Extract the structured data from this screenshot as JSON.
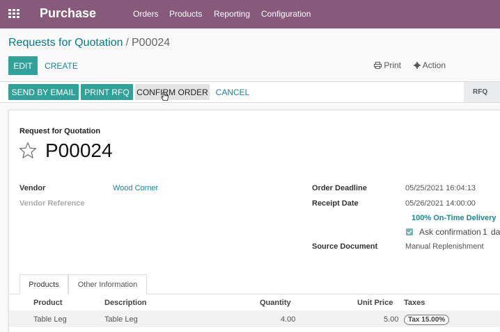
{
  "navbar": {
    "app_name": "Purchase",
    "menu": [
      {
        "label": "Orders"
      },
      {
        "label": "Products"
      },
      {
        "label": "Reporting"
      },
      {
        "label": "Configuration"
      }
    ],
    "color": "#875a7b"
  },
  "breadcrumb": {
    "parent": "Requests for Quotation",
    "separator": "/",
    "current": "P00024"
  },
  "toolbar": {
    "edit_label": "EDIT",
    "create_label": "CREATE",
    "print_label": "Print",
    "action_label": "Action"
  },
  "statusbar": {
    "send_email_label": "SEND BY EMAIL",
    "print_rfq_label": "PRINT RFQ",
    "confirm_label": "CONFIRM ORDER",
    "cancel_label": "CANCEL",
    "stage_label": "RFQ"
  },
  "form": {
    "doc_type": "Request for Quotation",
    "doc_name": "P00024",
    "vendor_label": "Vendor",
    "vendor_value": "Wood Corner",
    "vendor_ref_label": "Vendor Reference",
    "order_deadline_label": "Order Deadline",
    "order_deadline_value": "05/25/2021 16:04:13",
    "receipt_date_label": "Receipt Date",
    "receipt_date_value": "05/26/2021 14:00:00",
    "on_time_delivery": "100% On-Time Delivery",
    "ask_confirmation": "Ask confirmation",
    "ask_confirmation_days": "1",
    "ask_confirmation_unit": "da",
    "source_document_label": "Source Document",
    "source_document_value": "Manual Replenishment"
  },
  "tabs": [
    {
      "label": "Products",
      "active": true
    },
    {
      "label": "Other Information",
      "active": false
    }
  ],
  "order_lines": {
    "columns": [
      "Product",
      "Description",
      "Quantity",
      "Unit Price",
      "Taxes"
    ],
    "rows": [
      {
        "product": "Table Leg",
        "description": "Table Leg",
        "quantity": "4.00",
        "unit_price": "5.00",
        "taxes": "Tax 15.00%"
      }
    ]
  },
  "colors": {
    "primary": "#31a29a",
    "link": "#17888f",
    "brand": "#875a7b"
  },
  "icons": [
    "apps-grid-icon",
    "print-icon",
    "gear-icon",
    "star-icon",
    "cursor-hand-icon",
    "checkbox-checked-icon"
  ]
}
